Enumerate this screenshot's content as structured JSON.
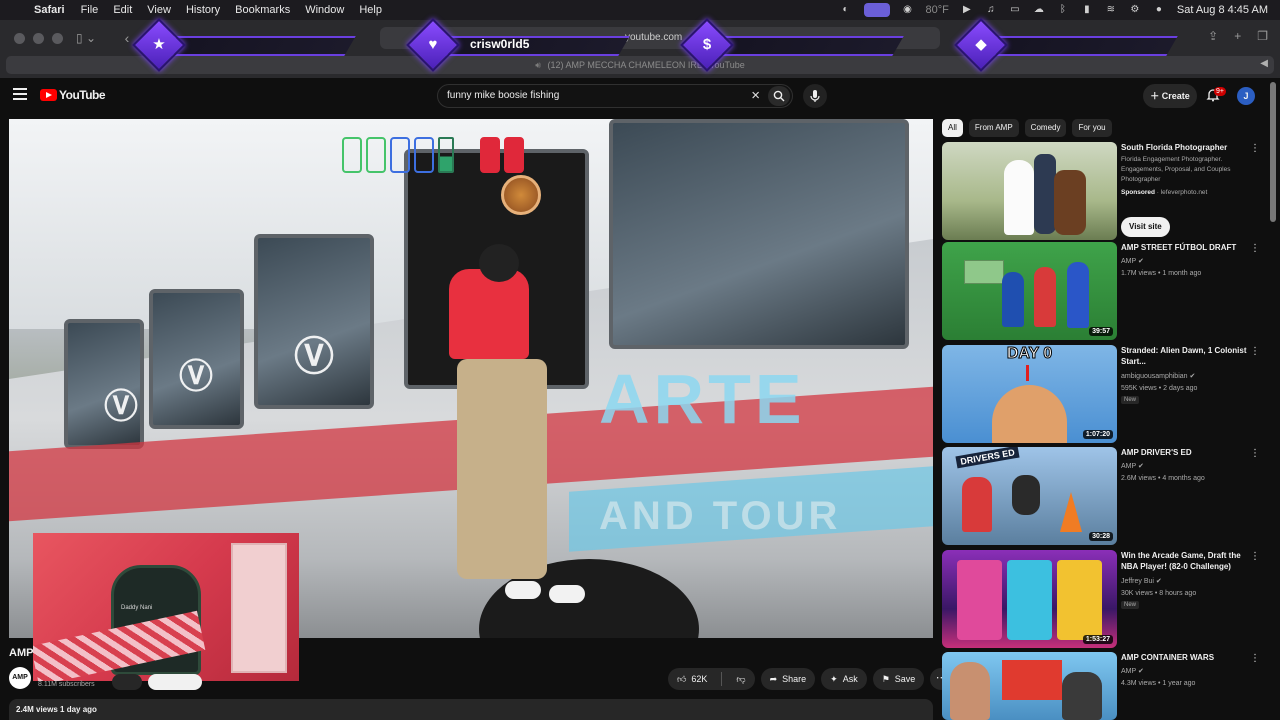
{
  "menubar": {
    "app": "Safari",
    "items": [
      "File",
      "Edit",
      "View",
      "History",
      "Bookmarks",
      "Window",
      "Help"
    ],
    "temperature": "80°F",
    "datetime": "Sat Aug 8  4:45 AM"
  },
  "safari": {
    "url": "youtube.com",
    "tab_title": "(12) AMP MECCHA CHAMELEON IRL - YouTube"
  },
  "overlay": {
    "banners": [
      {
        "icon": "star-icon",
        "glyph": "★",
        "text": ""
      },
      {
        "icon": "heart-icon",
        "glyph": "♥",
        "text": "crisw0rld5"
      },
      {
        "icon": "dollar-icon",
        "glyph": "$",
        "text": ""
      },
      {
        "icon": "diamond-icon",
        "glyph": "◆",
        "text": ""
      }
    ],
    "webcam_chair_label": "Daddy Nani"
  },
  "youtube": {
    "logo": "YouTube",
    "search_query": "funny mike boosie fishing",
    "create_label": "Create",
    "notif_count": "9+",
    "avatar_initial": "J"
  },
  "video": {
    "bus_text_1": "ARTE",
    "bus_text_2": "AND TOUR",
    "channel": "AMP",
    "channel_avatar": "AMP",
    "subscribers": "8.11M subscribers",
    "likes": "62K",
    "share_label": "Share",
    "ask_label": "Ask",
    "save_label": "Save",
    "views_line": "2.4M views  1 day ago"
  },
  "chips": [
    "All",
    "From AMP",
    "Comedy",
    "For you"
  ],
  "recommendations": [
    {
      "title": "South Florida Photographer",
      "meta": "Florida Engagement Photographer. Engagements, Proposal, and Couples Photographer",
      "sponsored": "Sponsored",
      "domain": "lefeverphoto.net",
      "cta": "Visit site"
    },
    {
      "title": "AMP STREET FÚTBOL DRAFT",
      "channel": "AMP",
      "stats": "1.7M views • 1 month ago",
      "duration": "39:57"
    },
    {
      "title": "Stranded: Alien Dawn, 1 Colonist Start...",
      "channel": "ambiguousamphibian",
      "stats": "595K views • 2 days ago",
      "badge": "New",
      "duration": "1:07:20",
      "thumb_text": "DAY 0"
    },
    {
      "title": "AMP DRIVER'S ED",
      "channel": "AMP",
      "stats": "2.6M views • 4 months ago",
      "duration": "30:28",
      "thumb_text": "DRIVERS ED"
    },
    {
      "title": "Win the Arcade Game, Draft the NBA Player! (82-0 Challenge)",
      "channel": "Jeffrey Bui",
      "stats": "30K views • 8 hours ago",
      "badge": "New",
      "duration": "1:53:27"
    },
    {
      "title": "AMP CONTAINER WARS",
      "channel": "AMP",
      "stats": "4.3M views • 1 year ago"
    }
  ],
  "colors": {
    "yt_red": "#ff0000",
    "overlay_purple": "#6a3fe0",
    "background": "#0f0f0f"
  }
}
